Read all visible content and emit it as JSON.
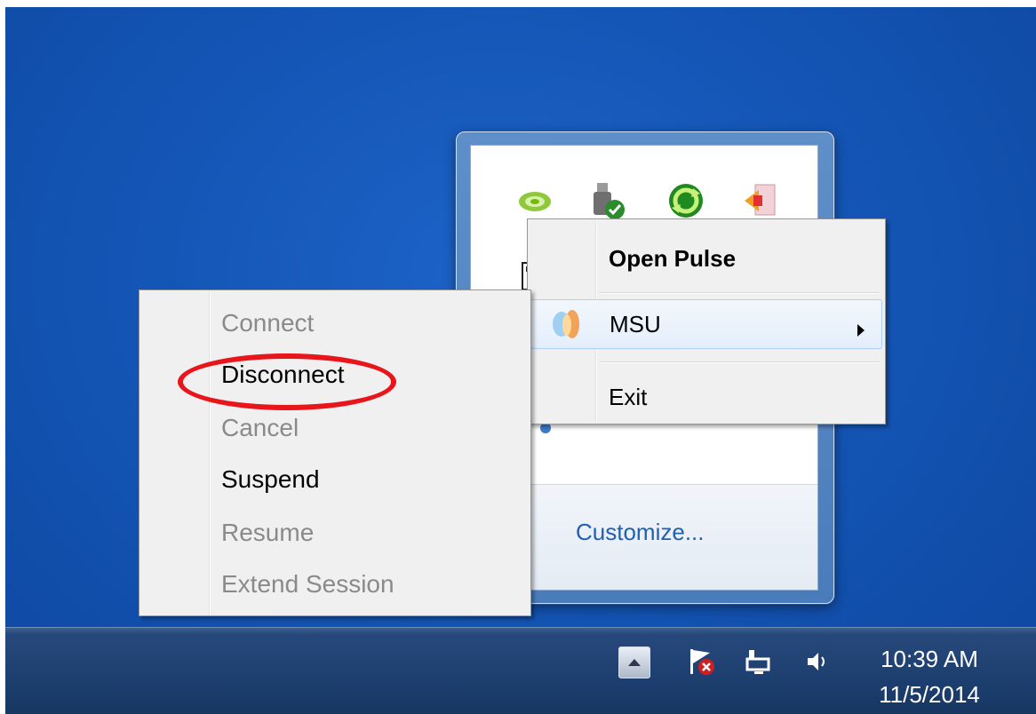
{
  "tray_flyout": {
    "icons": [
      "nvidia-icon",
      "usb-safely-remove-icon",
      "sync-icon",
      "backup-icon",
      "network-plug-icon",
      "pulse-secure-icon"
    ],
    "customize_link": "Customize..."
  },
  "context_menu": {
    "items": [
      {
        "label": "Open Pulse",
        "bold": true
      },
      {
        "label": "MSU",
        "has_submenu": true,
        "icon": "pulse-connection-icon"
      },
      {
        "label": "Exit"
      }
    ]
  },
  "submenu": {
    "items": [
      {
        "label": "Connect",
        "enabled": false
      },
      {
        "label": "Disconnect",
        "enabled": true
      },
      {
        "label": "Cancel",
        "enabled": false
      },
      {
        "label": "Suspend",
        "enabled": true
      },
      {
        "label": "Resume",
        "enabled": false
      },
      {
        "label": "Extend Session",
        "enabled": false
      }
    ]
  },
  "annotation": {
    "highlighted_item": "Disconnect",
    "color": "#e8151b"
  },
  "taskbar": {
    "tray_icons": [
      "show-hidden-icons-button",
      "action-center-flag-icon",
      "network-icon",
      "volume-icon"
    ],
    "time": "10:39 AM",
    "date": "11/5/2014"
  },
  "colors": {
    "desktop": "#1456b6",
    "taskbar": "#1d3f70",
    "link": "#1f5fb4"
  }
}
